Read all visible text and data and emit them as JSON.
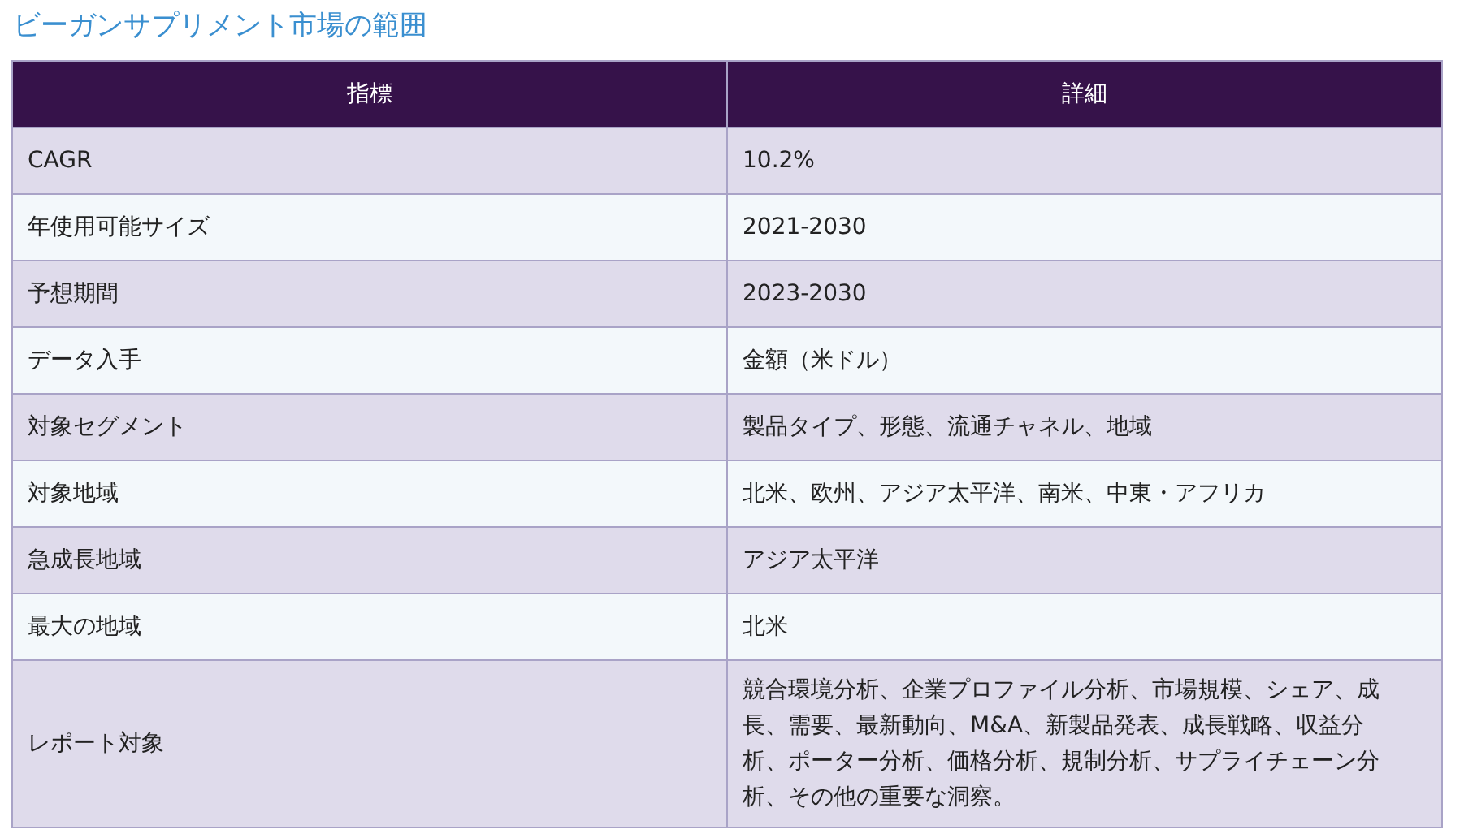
{
  "title": "ビーガンサプリメント市場の範囲",
  "table": {
    "columns": [
      "指標",
      "詳細"
    ],
    "rows": [
      [
        "CAGR",
        "10.2%"
      ],
      [
        "年使用可能サイズ",
        "2021-2030"
      ],
      [
        "予想期間",
        "2023-2030"
      ],
      [
        "データ入手",
        "金額（米ドル）"
      ],
      [
        "対象セグメント",
        "製品タイプ、形態、流通チャネル、地域"
      ],
      [
        "対象地域",
        "北米、欧州、アジア太平洋、南米、中東・アフリカ"
      ],
      [
        "急成長地域",
        "アジア太平洋"
      ],
      [
        "最大の地域",
        "北米"
      ],
      [
        "レポート対象",
        "競合環境分析、企業プロファイル分析、市場規模、シェア、成長、需要、最新動向、M&A、新製品発表、成長戦略、収益分析、ポーター分析、価格分析、規制分析、サプライチェーン分析、その他の重要な洞察。"
      ]
    ]
  }
}
